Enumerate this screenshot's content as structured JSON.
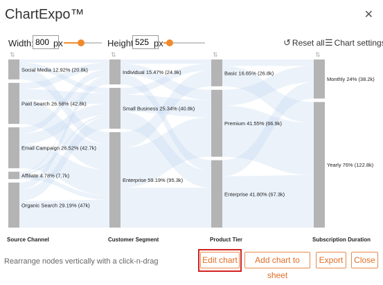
{
  "dialog": {
    "title": "ChartExpo™",
    "close_glyph": "✕"
  },
  "toolbar": {
    "width_label": "Width:",
    "width_value": "800",
    "width_unit": "px",
    "width_slider_level": 0.45,
    "height_label": "Height:",
    "height_value": "525",
    "height_unit": "px",
    "height_slider_level": 0.15,
    "reset_label": "Reset all",
    "settings_label": "Chart settings"
  },
  "chart_data": {
    "type": "sankey",
    "columns": [
      "Source Channel",
      "Customer Segment",
      "Product Tier",
      "Subscription Duration"
    ],
    "nodes": [
      {
        "col": 0,
        "label": "Social Media 12.92% (20.8k)",
        "value": 20.8
      },
      {
        "col": 0,
        "label": "Paid Search 26.58% (42.8k)",
        "value": 42.8
      },
      {
        "col": 0,
        "label": "Email Campaign 26.52% (42.7k)",
        "value": 42.7
      },
      {
        "col": 0,
        "label": "Affiliate 4.78% (7.7k)",
        "value": 7.7
      },
      {
        "col": 0,
        "label": "Organic Search 29.19% (47k)",
        "value": 47.0
      },
      {
        "col": 1,
        "label": "Individual 15.47% (24.9k)",
        "value": 24.9
      },
      {
        "col": 1,
        "label": "Small Business 25.34% (40.8k)",
        "value": 40.8
      },
      {
        "col": 1,
        "label": "Enterprise 59.19% (95.3k)",
        "value": 95.3
      },
      {
        "col": 2,
        "label": "Basic 16.65% (26.8k)",
        "value": 26.8
      },
      {
        "col": 2,
        "label": "Premium 41.55% (66.9k)",
        "value": 66.9
      },
      {
        "col": 2,
        "label": "Enterprise 41.80% (67.3k)",
        "value": 67.3
      },
      {
        "col": 3,
        "label": "Monthly 24% (38.2k)",
        "value": 38.2
      },
      {
        "col": 3,
        "label": "Yearly 76% (122.8k)",
        "value": 122.8
      }
    ]
  },
  "footer": {
    "hint": "Rearrange nodes vertically with a click-n-drag",
    "edit_chart": "Edit chart",
    "add_chart": "Add chart to sheet",
    "export": "Export",
    "close": "Close"
  }
}
